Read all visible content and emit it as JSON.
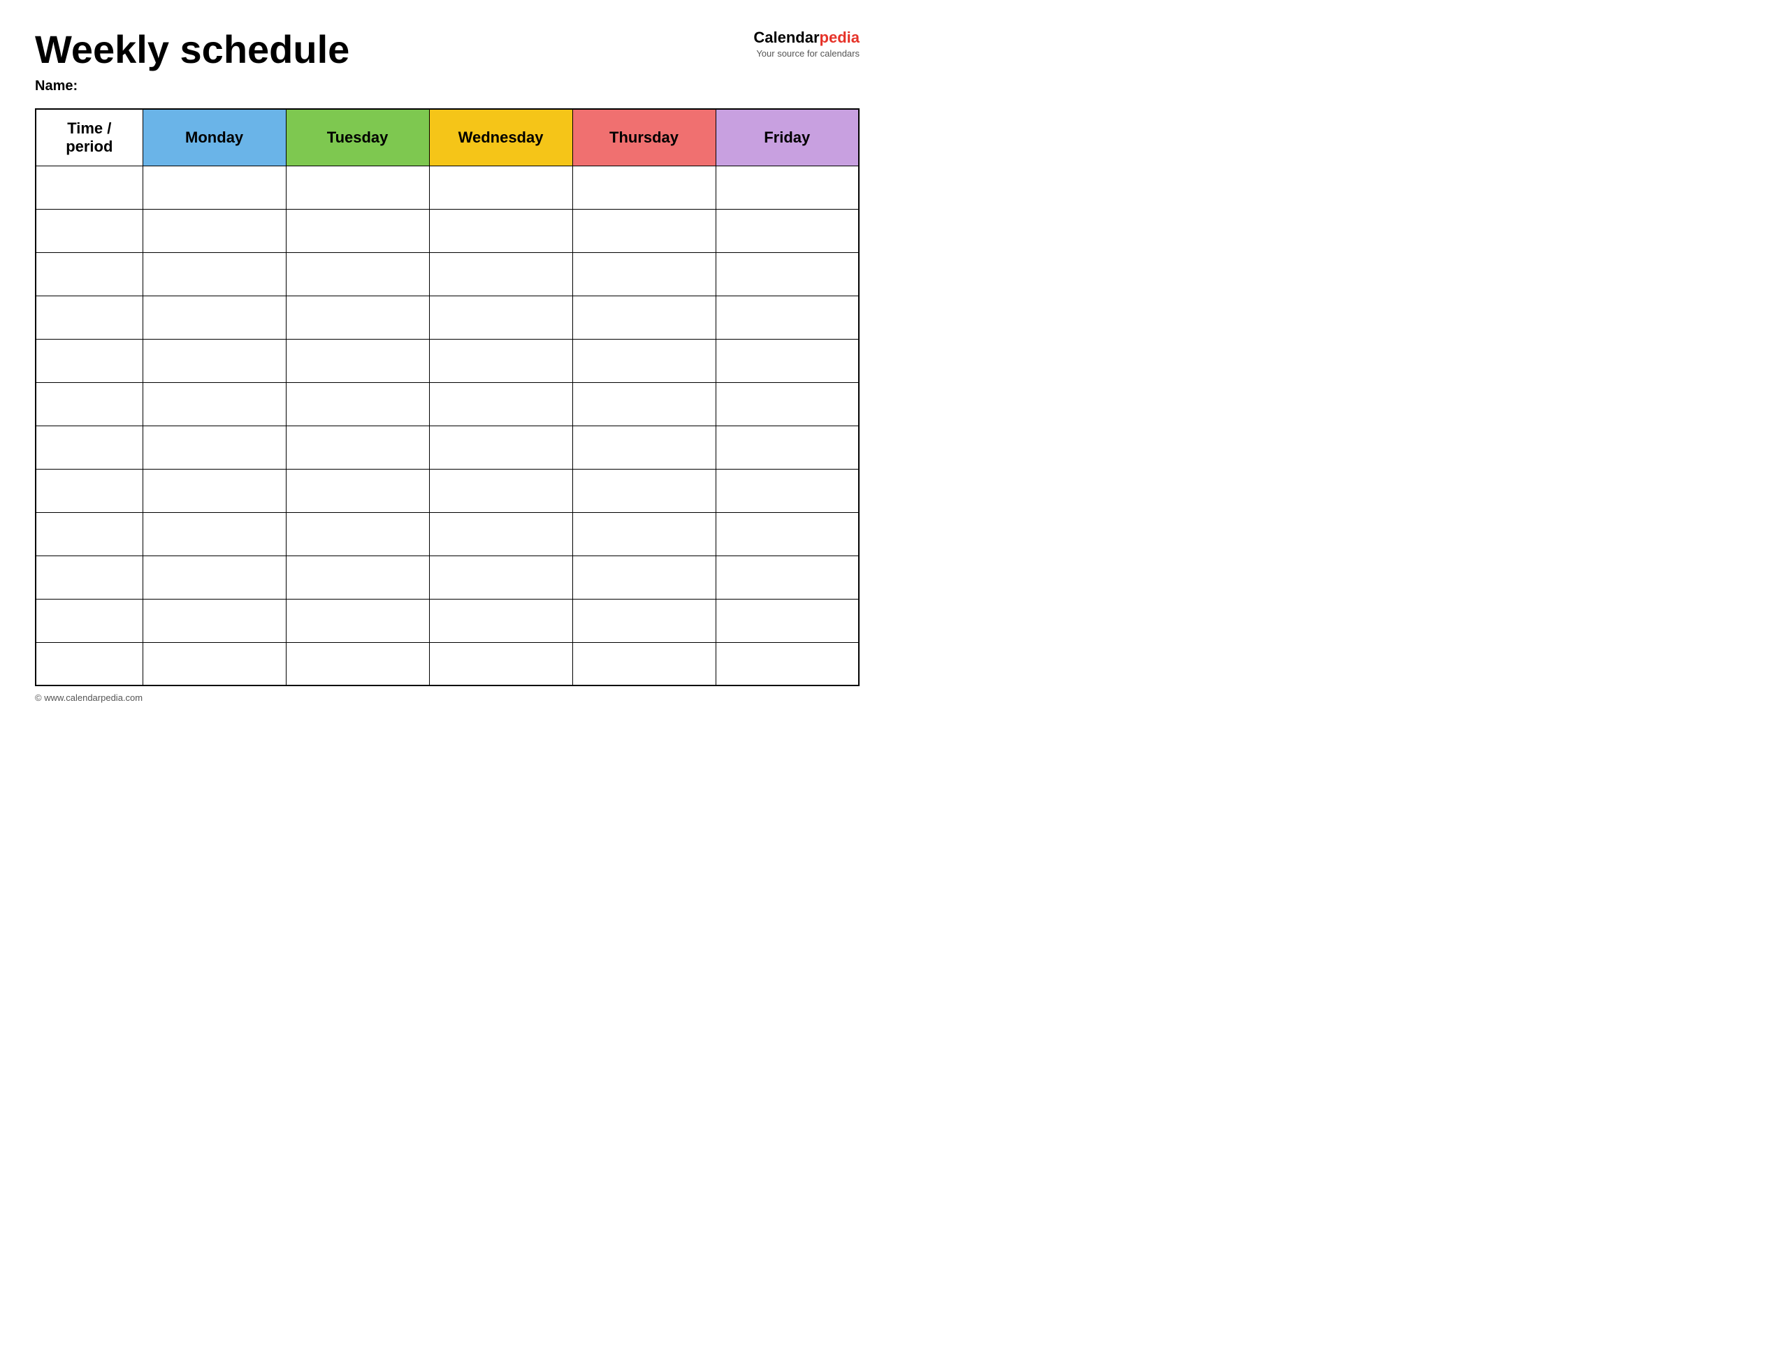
{
  "header": {
    "title": "Weekly schedule",
    "brand_name_part1": "Calendar",
    "brand_name_part2": "pedia",
    "brand_tagline": "Your source for calendars",
    "name_label": "Name:"
  },
  "table": {
    "columns": [
      {
        "id": "time",
        "label": "Time / period",
        "color_class": "th-time"
      },
      {
        "id": "monday",
        "label": "Monday",
        "color_class": "th-monday"
      },
      {
        "id": "tuesday",
        "label": "Tuesday",
        "color_class": "th-tuesday"
      },
      {
        "id": "wednesday",
        "label": "Wednesday",
        "color_class": "th-wednesday"
      },
      {
        "id": "thursday",
        "label": "Thursday",
        "color_class": "th-thursday"
      },
      {
        "id": "friday",
        "label": "Friday",
        "color_class": "th-friday"
      }
    ],
    "row_count": 12
  },
  "footer": {
    "copyright": "© www.calendarpedia.com"
  }
}
